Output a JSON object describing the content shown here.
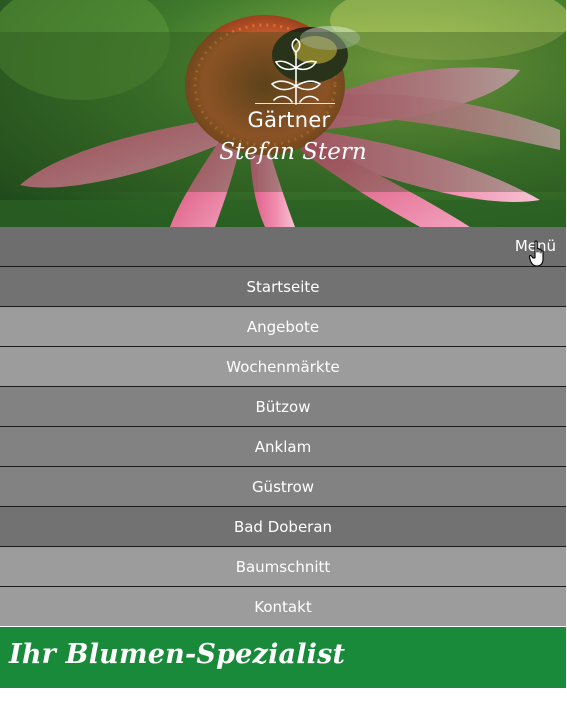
{
  "header": {
    "brand_line1": "Gärtner",
    "brand_line2": "Stefan Stern",
    "logo_icon": "sprout-icon",
    "background_image": "coneflower-with-bee"
  },
  "menu": {
    "toggle_label": "Menü"
  },
  "nav": {
    "items": [
      {
        "label": "Startseite"
      },
      {
        "label": "Angebote"
      },
      {
        "label": "Wochenmärkte"
      },
      {
        "label": "Bützow"
      },
      {
        "label": "Anklam"
      },
      {
        "label": "Güstrow"
      },
      {
        "label": "Bad Doberan"
      },
      {
        "label": "Baumschnitt"
      },
      {
        "label": "Kontakt"
      }
    ]
  },
  "content": {
    "headline": "Ihr Blumen-Spezialist"
  },
  "colors": {
    "accent_green": "#198a3a",
    "nav_dark": "#727272",
    "nav_light": "#9c9c9c",
    "text": "#ffffff"
  }
}
